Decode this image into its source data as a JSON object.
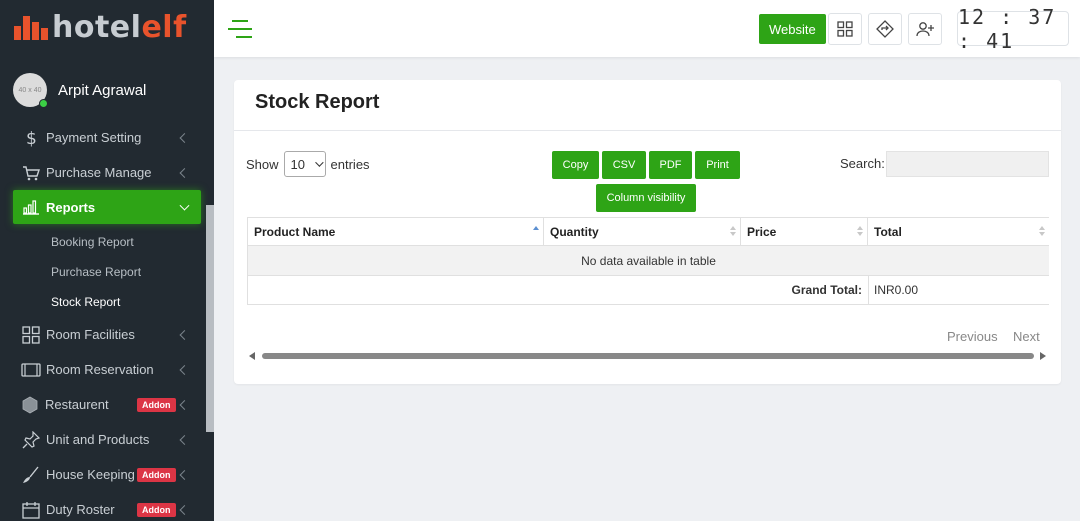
{
  "brand": {
    "name_part1": "hotel",
    "name_part2": "elf",
    "accent_color": "#e8532c"
  },
  "user": {
    "avatar_placeholder": "40 x 40",
    "name": "Arpit Agrawal",
    "status": "online"
  },
  "sidebar": {
    "items": [
      {
        "label": "Payment Setting",
        "icon": "dollar-icon"
      },
      {
        "label": "Purchase Manage",
        "icon": "cart-icon"
      },
      {
        "label": "Reports",
        "icon": "bar-chart-icon",
        "active": true,
        "children": [
          {
            "label": "Booking Report"
          },
          {
            "label": "Purchase Report"
          },
          {
            "label": "Stock Report",
            "current": true
          }
        ]
      },
      {
        "label": "Room Facilities",
        "icon": "grid-icon"
      },
      {
        "label": "Room Reservation",
        "icon": "film-icon"
      },
      {
        "label": "Restaurent",
        "icon": "hexagon-icon",
        "badge": "Addon"
      },
      {
        "label": "Unit and Products",
        "icon": "pin-icon"
      },
      {
        "label": "House Keeping",
        "icon": "broom-icon",
        "badge": "Addon"
      },
      {
        "label": "Duty Roster",
        "icon": "calendar-icon",
        "badge": "Addon"
      }
    ]
  },
  "topbar": {
    "website_label": "Website",
    "icons": [
      "apps-grid-icon",
      "diamond-direction-icon",
      "add-user-icon"
    ],
    "clock": "12:37:41"
  },
  "page": {
    "title": "Stock Report"
  },
  "table_controls": {
    "show_label": "Show",
    "page_length": "10",
    "entries_label": "entries",
    "search_label": "Search:",
    "search_value": "",
    "buttons": {
      "copy": "Copy",
      "csv": "CSV",
      "pdf": "PDF",
      "print": "Print",
      "column_visibility": "Column visibility"
    }
  },
  "table": {
    "columns": [
      "Product Name",
      "Quantity",
      "Price",
      "Total"
    ],
    "empty_message": "No data available in table",
    "footer_label": "Grand Total:",
    "footer_value": "INR0.00"
  },
  "pagination": {
    "previous": "Previous",
    "next": "Next"
  },
  "colors": {
    "primary": "#2ea416",
    "sidebar_bg": "#222a31",
    "badge": "#dc3545"
  }
}
